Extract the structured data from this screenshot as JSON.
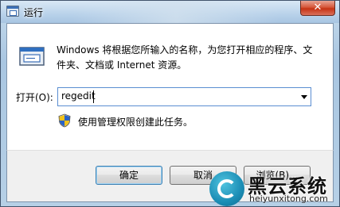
{
  "window": {
    "title": "运行",
    "close_glyph": "✕"
  },
  "dialog": {
    "description": "Windows 将根据您所输入的名称，为您打开相应的程序、文件夹、文档或 Internet 资源。",
    "open_label": "打开(O):",
    "open_value": "regedit",
    "admin_note": "使用管理权限创建此任务。"
  },
  "buttons": {
    "ok": "确定",
    "cancel": "取消",
    "browse": "浏览(B)..."
  },
  "watermark": {
    "name": "黑云系统",
    "url": "heiyunxitong.com"
  },
  "icons": {
    "app": "run-icon",
    "shield": "uac-shield-icon"
  },
  "colors": {
    "close_button": "#c63314",
    "combo_border": "#5a8ed1",
    "default_button_border": "#3c7fb1"
  }
}
